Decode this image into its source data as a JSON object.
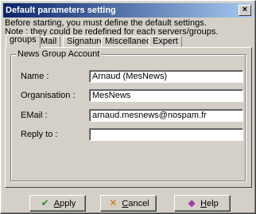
{
  "window": {
    "title": "Default parameters setting",
    "close_symbol": "×"
  },
  "intro": {
    "line1": "Before starting, you must define the default settings.",
    "line2": "Note : they could be redefined for each servers/groups."
  },
  "tabs": [
    {
      "label": "groups",
      "active": true
    },
    {
      "label": "Mail"
    },
    {
      "label": "Signature"
    },
    {
      "label": "Miscellaneous"
    },
    {
      "label": "Expert"
    }
  ],
  "group": {
    "title": "News Group Account",
    "fields": {
      "name": {
        "label": "Name :",
        "value": "Arnaud (MesNews)"
      },
      "organisation": {
        "label": "Organisation :",
        "value": "MesNews"
      },
      "email": {
        "label": "EMail :",
        "value": "arnaud.mesnews@nospam.fr"
      },
      "reply_to": {
        "label": "Reply to :",
        "value": ""
      }
    }
  },
  "buttons": {
    "apply": {
      "label_first": "A",
      "label_rest": "pply",
      "icon": "checkmark-icon"
    },
    "cancel": {
      "label_first": "C",
      "label_rest": "ancel",
      "icon": "cross-icon"
    },
    "help": {
      "label_first": "H",
      "label_rest": "elp",
      "icon": "help-book-icon"
    }
  },
  "colors": {
    "titlebar_start": "#0a246a",
    "titlebar_end": "#a6caf0",
    "face": "#d4d0c8"
  }
}
